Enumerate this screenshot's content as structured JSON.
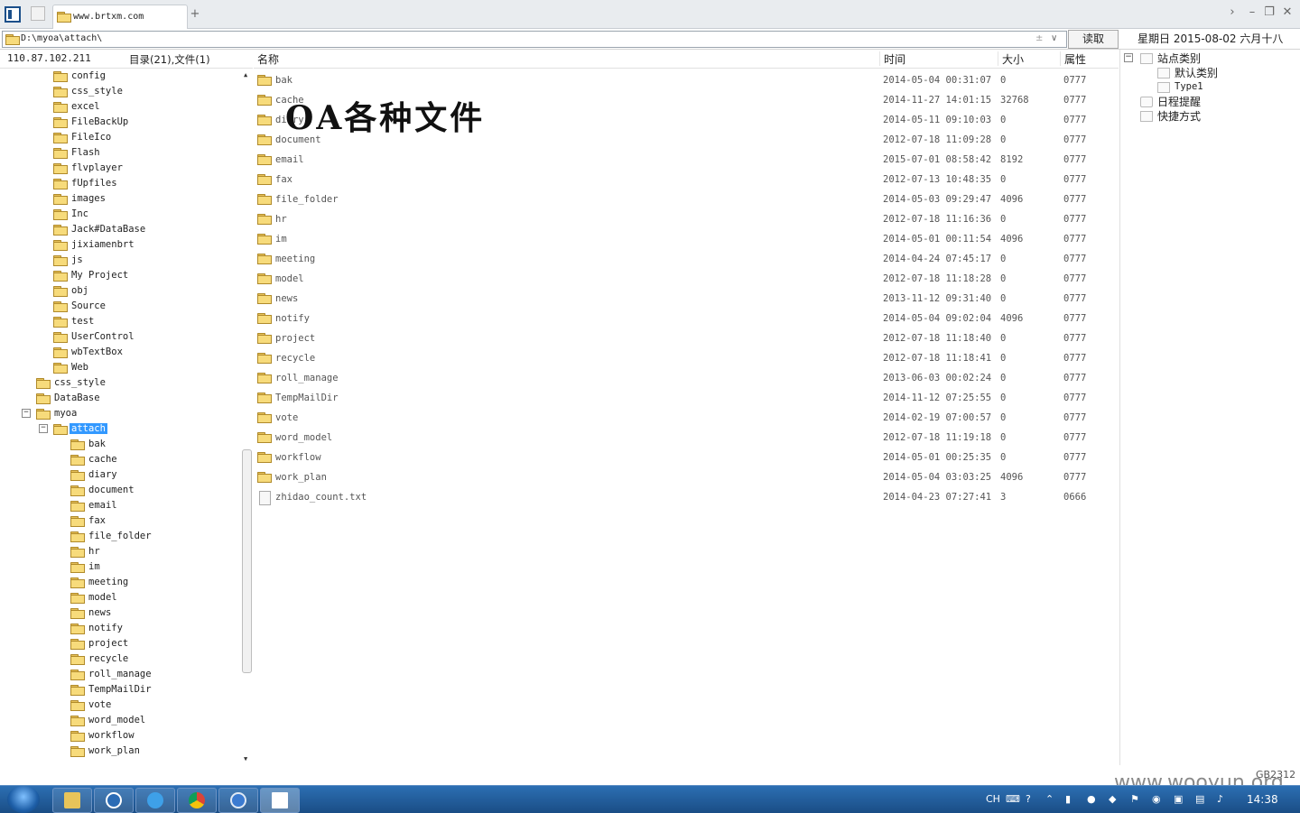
{
  "tab": {
    "title": "www.brtxm.com",
    "new_tab_symbol": "+"
  },
  "address": {
    "path": "D:\\myoa\\attach\\",
    "read_button": "读取",
    "plus_symbol": "±",
    "dropdown_symbol": "∨"
  },
  "date_text": "星期日  2015-08-02  六月十八",
  "status": {
    "ip": "110.87.102.211",
    "dir_count": "目录(21),文件(1)"
  },
  "tree": [
    {
      "label": "config",
      "level": 3
    },
    {
      "label": "css_style",
      "level": 3
    },
    {
      "label": "excel",
      "level": 3
    },
    {
      "label": "FileBackUp",
      "level": 3
    },
    {
      "label": "FileIco",
      "level": 3
    },
    {
      "label": "Flash",
      "level": 3
    },
    {
      "label": "flvplayer",
      "level": 3
    },
    {
      "label": "fUpfiles",
      "level": 3
    },
    {
      "label": "images",
      "level": 3
    },
    {
      "label": "Inc",
      "level": 3
    },
    {
      "label": "Jack#DataBase",
      "level": 3
    },
    {
      "label": "jixiamenbrt",
      "level": 3
    },
    {
      "label": "js",
      "level": 3
    },
    {
      "label": "My Project",
      "level": 3
    },
    {
      "label": "obj",
      "level": 3
    },
    {
      "label": "Source",
      "level": 3
    },
    {
      "label": "test",
      "level": 3
    },
    {
      "label": "UserControl",
      "level": 3
    },
    {
      "label": "wbTextBox",
      "level": 3
    },
    {
      "label": "Web",
      "level": 3
    },
    {
      "label": "css_style",
      "level": 2
    },
    {
      "label": "DataBase",
      "level": 2
    },
    {
      "label": "myoa",
      "level": 2,
      "expander": "−"
    },
    {
      "label": "attach",
      "level": 3,
      "expander": "−",
      "selected": true
    },
    {
      "label": "bak",
      "level": 4
    },
    {
      "label": "cache",
      "level": 4
    },
    {
      "label": "diary",
      "level": 4
    },
    {
      "label": "document",
      "level": 4
    },
    {
      "label": "email",
      "level": 4
    },
    {
      "label": "fax",
      "level": 4
    },
    {
      "label": "file_folder",
      "level": 4
    },
    {
      "label": "hr",
      "level": 4
    },
    {
      "label": "im",
      "level": 4
    },
    {
      "label": "meeting",
      "level": 4
    },
    {
      "label": "model",
      "level": 4
    },
    {
      "label": "news",
      "level": 4
    },
    {
      "label": "notify",
      "level": 4
    },
    {
      "label": "project",
      "level": 4
    },
    {
      "label": "recycle",
      "level": 4
    },
    {
      "label": "roll_manage",
      "level": 4
    },
    {
      "label": "TempMailDir",
      "level": 4
    },
    {
      "label": "vote",
      "level": 4
    },
    {
      "label": "word_model",
      "level": 4
    },
    {
      "label": "workflow",
      "level": 4
    },
    {
      "label": "work_plan",
      "level": 4
    }
  ],
  "list_header": {
    "name": "名称",
    "time": "时间",
    "size": "大小",
    "attr": "属性"
  },
  "files": [
    {
      "name": "bak",
      "time": "2014-05-04 00:31:07",
      "size": "0",
      "attr": "0777",
      "type": "folder"
    },
    {
      "name": "cache",
      "time": "2014-11-27 14:01:15",
      "size": "32768",
      "attr": "0777",
      "type": "folder"
    },
    {
      "name": "diary",
      "time": "2014-05-11 09:10:03",
      "size": "0",
      "attr": "0777",
      "type": "folder"
    },
    {
      "name": "document",
      "time": "2012-07-18 11:09:28",
      "size": "0",
      "attr": "0777",
      "type": "folder"
    },
    {
      "name": "email",
      "time": "2015-07-01 08:58:42",
      "size": "8192",
      "attr": "0777",
      "type": "folder"
    },
    {
      "name": "fax",
      "time": "2012-07-13 10:48:35",
      "size": "0",
      "attr": "0777",
      "type": "folder"
    },
    {
      "name": "file_folder",
      "time": "2014-05-03 09:29:47",
      "size": "4096",
      "attr": "0777",
      "type": "folder"
    },
    {
      "name": "hr",
      "time": "2012-07-18 11:16:36",
      "size": "0",
      "attr": "0777",
      "type": "folder"
    },
    {
      "name": "im",
      "time": "2014-05-01 00:11:54",
      "size": "4096",
      "attr": "0777",
      "type": "folder"
    },
    {
      "name": "meeting",
      "time": "2014-04-24 07:45:17",
      "size": "0",
      "attr": "0777",
      "type": "folder"
    },
    {
      "name": "model",
      "time": "2012-07-18 11:18:28",
      "size": "0",
      "attr": "0777",
      "type": "folder"
    },
    {
      "name": "news",
      "time": "2013-11-12 09:31:40",
      "size": "0",
      "attr": "0777",
      "type": "folder"
    },
    {
      "name": "notify",
      "time": "2014-05-04 09:02:04",
      "size": "4096",
      "attr": "0777",
      "type": "folder"
    },
    {
      "name": "project",
      "time": "2012-07-18 11:18:40",
      "size": "0",
      "attr": "0777",
      "type": "folder"
    },
    {
      "name": "recycle",
      "time": "2012-07-18 11:18:41",
      "size": "0",
      "attr": "0777",
      "type": "folder"
    },
    {
      "name": "roll_manage",
      "time": "2013-06-03 00:02:24",
      "size": "0",
      "attr": "0777",
      "type": "folder"
    },
    {
      "name": "TempMailDir",
      "time": "2014-11-12 07:25:55",
      "size": "0",
      "attr": "0777",
      "type": "folder"
    },
    {
      "name": "vote",
      "time": "2014-02-19 07:00:57",
      "size": "0",
      "attr": "0777",
      "type": "folder"
    },
    {
      "name": "word_model",
      "time": "2012-07-18 11:19:18",
      "size": "0",
      "attr": "0777",
      "type": "folder"
    },
    {
      "name": "workflow",
      "time": "2014-05-01 00:25:35",
      "size": "0",
      "attr": "0777",
      "type": "folder"
    },
    {
      "name": "work_plan",
      "time": "2014-05-04 03:03:25",
      "size": "4096",
      "attr": "0777",
      "type": "folder"
    },
    {
      "name": "zhidao_count.txt",
      "time": "2014-04-23 07:27:41",
      "size": "3",
      "attr": "0666",
      "type": "file"
    }
  ],
  "overlay_text": "OA各种文件",
  "right_panel": {
    "site_category": "站点类别",
    "default_category": "默认类别",
    "type1": "Type1",
    "schedule": "日程提醒",
    "shortcut": "快捷方式"
  },
  "taskbar": {
    "lang": "CH",
    "clock": "14:38"
  },
  "watermark": "www.wooyun.org",
  "encoding": "GB2312",
  "colors": {
    "selection": "#3399ff",
    "taskbar": "#1f5a9a"
  }
}
